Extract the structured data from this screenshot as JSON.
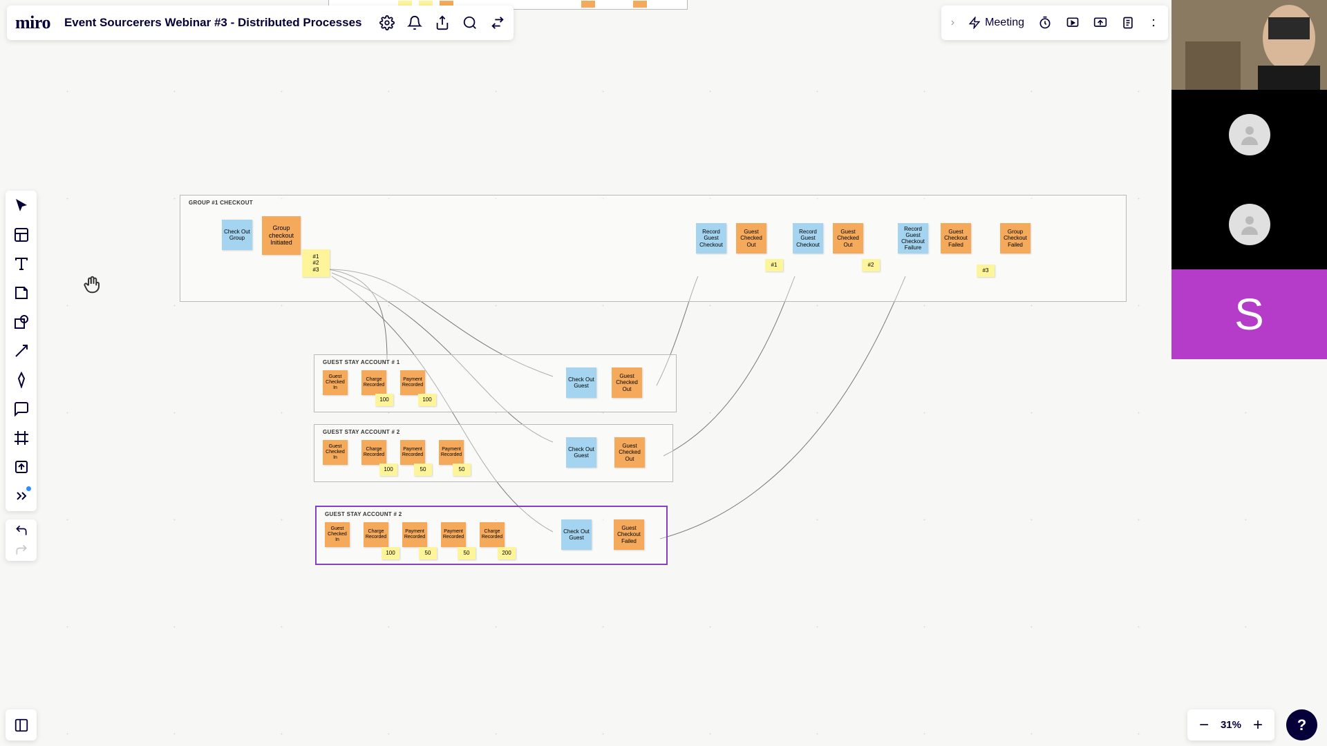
{
  "header": {
    "logo": "miro",
    "title": "Event Sourcerers Webinar #3 - Distributed Processes"
  },
  "right_bar": {
    "meeting": "Meeting"
  },
  "zoom": {
    "value": "31%"
  },
  "help": {
    "label": "?"
  },
  "participants": {
    "letter": "S"
  },
  "frames": {
    "group": {
      "title": "GROUP  #1 CHECKOUT"
    },
    "g1": {
      "title": "GUEST STAY ACCOUNT # 1"
    },
    "g2": {
      "title": "GUEST STAY ACCOUNT # 2"
    },
    "g3": {
      "title": "GUEST STAY ACCOUNT # 2"
    }
  },
  "stickies": {
    "group": {
      "checkout_group": "Check Out Group",
      "initiated": "Group checkout Initiated",
      "ids": "#1\n#2\n#3",
      "rec1": "Record Guest Checkout",
      "out1": "Guest Checked Out",
      "t1": "#1",
      "rec2": "Record Guest Checkout",
      "out2": "Guest Checked Out",
      "t2": "#2",
      "rec3": "Record Guest Checkout Failure",
      "fail": "Guest Checkout Failed",
      "t3": "#3",
      "groupfail": "Group Checkout Failed"
    },
    "g1": {
      "in": "Guest Checked In",
      "charge": "Charge Recorded",
      "ctag": "100",
      "pay": "Payment Recorded",
      "ptag": "100",
      "cmd": "Check Out Guest",
      "out": "Guest Checked Out"
    },
    "g2": {
      "in": "Guest Checked In",
      "charge": "Charge Recorded",
      "ctag": "100",
      "pay1": "Payment Recorded",
      "p1tag": "50",
      "pay2": "Payment Recorded",
      "p2tag": "50",
      "cmd": "Check Out Guest",
      "out": "Guest Checked Out"
    },
    "g3": {
      "in": "Guest Checked In",
      "charge1": "Charge Recorded",
      "c1tag": "100",
      "pay1": "Payment Recorded",
      "p1tag": "50",
      "pay2": "Payment Recorded",
      "p2tag": "50",
      "charge2": "Charge Recorded",
      "c2tag": "200",
      "cmd": "Check Out Guest",
      "fail": "Guest Checkout Failed"
    }
  }
}
